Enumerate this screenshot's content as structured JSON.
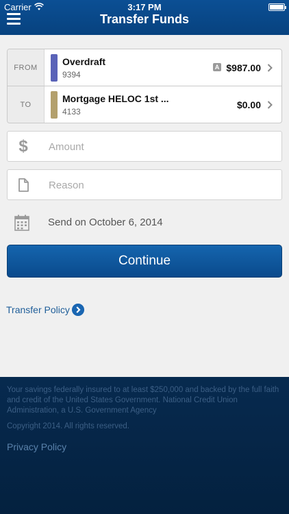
{
  "status_bar": {
    "carrier": "Carrier",
    "time": "3:17 PM"
  },
  "header": {
    "title": "Transfer Funds"
  },
  "transfer": {
    "from": {
      "label": "FROM",
      "name": "Overdraft",
      "number": "9394",
      "badge": "A",
      "amount": "$987.00",
      "color": "#5a63b8"
    },
    "to": {
      "label": "TO",
      "name": "Mortgage HELOC 1st ...",
      "number": "4133",
      "amount": "$0.00",
      "color": "#b3a06d"
    }
  },
  "amount_field": {
    "placeholder": "Amount",
    "value": ""
  },
  "reason_field": {
    "placeholder": "Reason",
    "value": ""
  },
  "date": {
    "text": "Send on October 6, 2014"
  },
  "continue_label": "Continue",
  "transfer_policy_label": "Transfer Policy",
  "footer": {
    "disclaimer": "Your savings federally insured to at least $250,000 and backed by the full faith and credit of the United States Government. National Credit Union Administration, a U.S. Government Agency",
    "copyright": "Copyright 2014. All rights reserved.",
    "privacy_label": "Privacy Policy"
  },
  "colors": {
    "brand": "#0b4f94",
    "link": "#1f5e99",
    "footer": "#072a4f"
  }
}
